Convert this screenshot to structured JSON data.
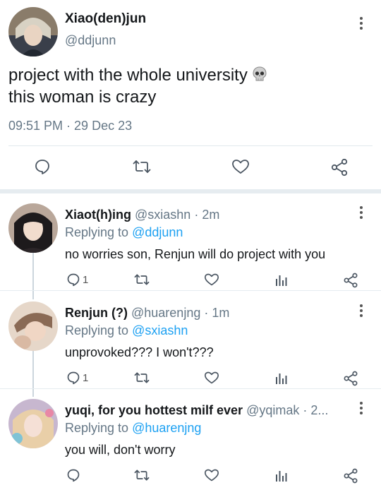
{
  "main_tweet": {
    "display_name": "Xiao(den)jun",
    "handle": "@ddjunn",
    "text_line1": "project with the whole university",
    "text_line2": "this woman is crazy",
    "timestamp": "09:51 PM · 29 Dec 23",
    "actions": [
      "reply-icon",
      "retweet-icon",
      "like-icon",
      "share-icon"
    ]
  },
  "replies": [
    {
      "display_name": "Xiaot(h)ing",
      "handle": "@sxiashn",
      "time": "· 2m",
      "replying_label": "Replying to ",
      "replying_to": "@ddjunn",
      "text": "no worries son, Renjun will do project with you",
      "reply_count": "1"
    },
    {
      "display_name": "Renjun (?)",
      "handle": "@huarenjng",
      "time": "· 1m",
      "replying_label": "Replying to ",
      "replying_to": "@sxiashn",
      "text": "unprovoked??? I won't???",
      "reply_count": "1"
    },
    {
      "display_name": "yuqi, for you hottest milf ever",
      "handle": "@yqimak",
      "time": "· 2...",
      "replying_label": "Replying to ",
      "replying_to": "@huarenjng",
      "text": "you will, don't worry",
      "reply_count": ""
    }
  ],
  "colors": {
    "link": "#1da1f2",
    "secondary_text": "#657786",
    "action_icon": "#4a5561",
    "thread_line": "#ccd6dd"
  }
}
